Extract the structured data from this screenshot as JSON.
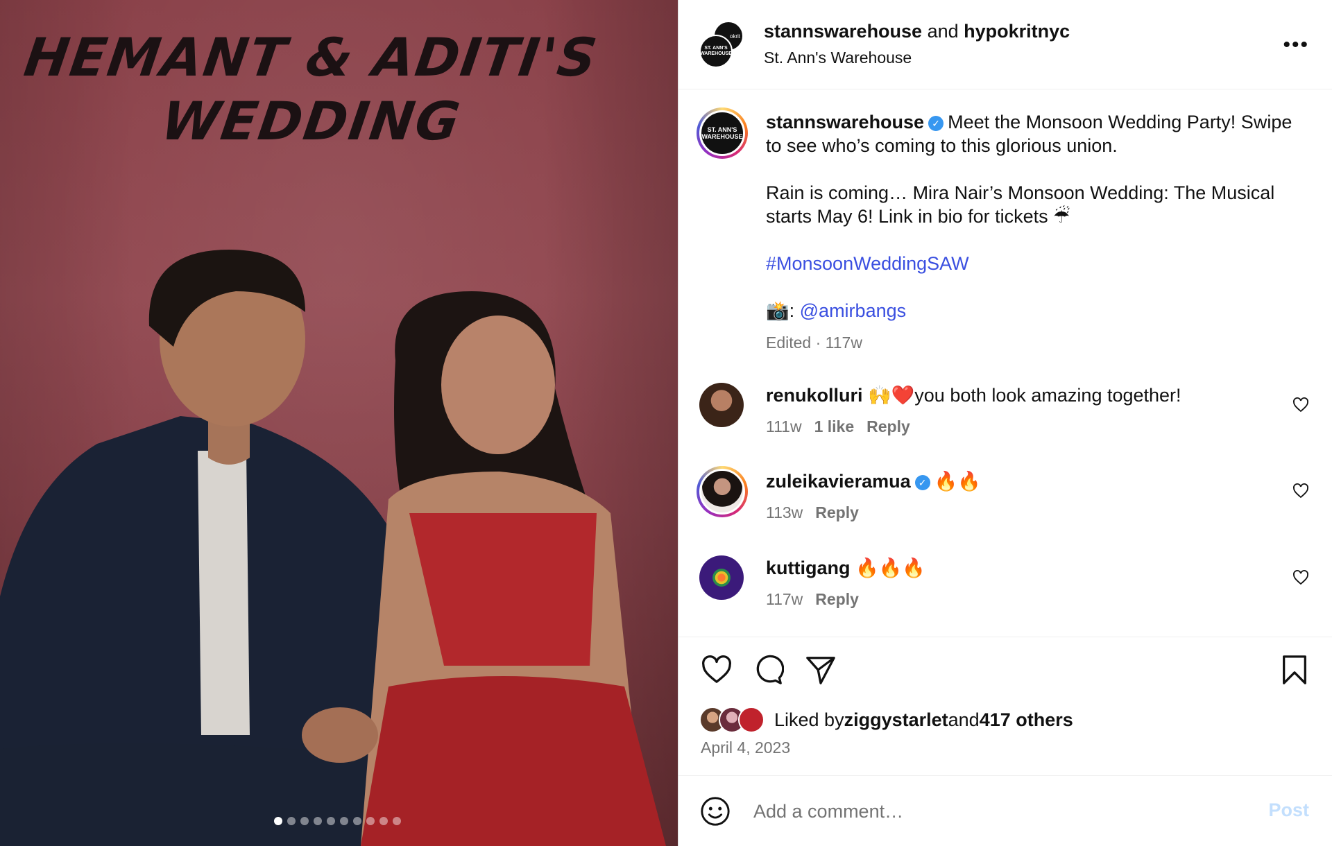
{
  "post_image": {
    "title_line1": "HEMANT & ADITI'S",
    "title_line2": "WEDDING",
    "carousel_total": 10,
    "carousel_active": 1
  },
  "header": {
    "account1": "stannswarehouse",
    "joiner": " and ",
    "account2": "hypokritnyc",
    "location": "St. Ann's Warehouse",
    "more_label": "•••",
    "logo_text": "ST. ANN'S WAREHOUSE",
    "logo_text_back": "okrit"
  },
  "caption": {
    "username": "stannswarehouse",
    "verified_mark": "✓",
    "line1": "Meet the Monsoon Wedding Party! Swipe to see who’s coming to this glorious union.",
    "line2": "Rain is coming… Mira Nair’s Monsoon Wedding: The Musical starts May 6! Link in bio for tickets ☔",
    "hashtag": "#MonsoonWeddingSAW",
    "credit_emoji": "📸:",
    "credit_handle": "@amirbangs",
    "meta": "Edited · 117w",
    "avatar_text": "ST. ANN'S WAREHOUSE"
  },
  "comments": [
    {
      "username": "renukolluri",
      "text": "🙌❤️you both look amazing together!",
      "age": "111w",
      "likes": "1 like",
      "reply": "Reply",
      "verified": false
    },
    {
      "username": "zuleikavieramua",
      "text": "🔥🔥",
      "age": "113w",
      "likes": "",
      "reply": "Reply",
      "verified": true
    },
    {
      "username": "kuttigang",
      "text": "🔥🔥🔥",
      "age": "117w",
      "likes": "",
      "reply": "Reply",
      "verified": false
    }
  ],
  "icons": {
    "like": "heart-icon",
    "comment": "comment-bubble-icon",
    "share": "paper-plane-icon",
    "save": "bookmark-icon",
    "emoji": "smiley-icon"
  },
  "likes": {
    "prefix": "Liked by ",
    "user": "ziggystarlet",
    "joiner": " and ",
    "others": "417 others"
  },
  "date": "April 4, 2023",
  "add_comment": {
    "placeholder": "Add a comment…",
    "post_label": "Post"
  },
  "colors": {
    "link": "#3a4fe0",
    "verified": "#3797f0",
    "muted": "#737373",
    "post_disabled": "#c3dffd",
    "photo_wall": "#8a4149"
  }
}
